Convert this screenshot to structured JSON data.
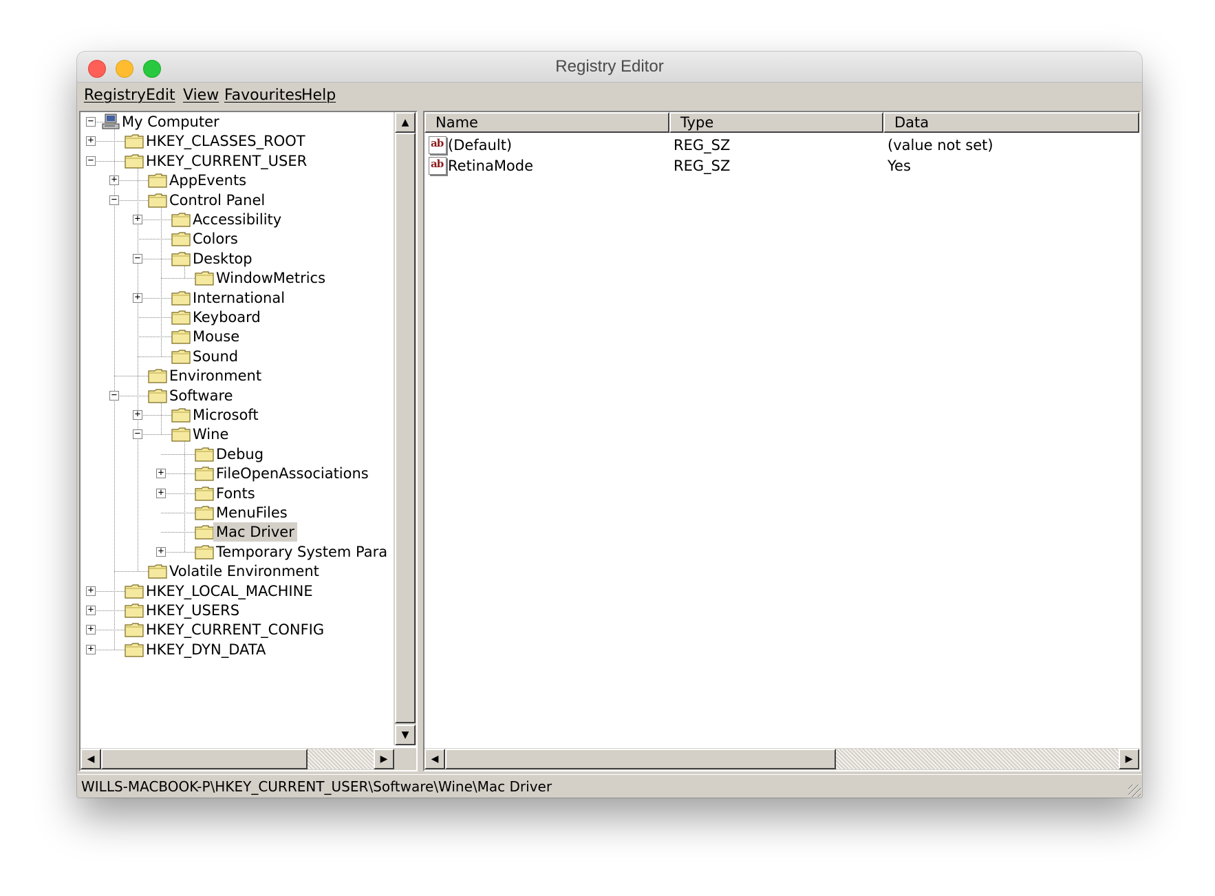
{
  "window": {
    "title": "Registry Editor"
  },
  "menu": [
    "Registry",
    "Edit",
    "View",
    "Favourites",
    "Help"
  ],
  "tree": {
    "root": {
      "label": "My Computer",
      "toggle": "−"
    },
    "nodes": [
      {
        "label": "HKEY_CLASSES_ROOT",
        "toggle": "+"
      },
      {
        "label": "HKEY_CURRENT_USER",
        "toggle": "−"
      },
      {
        "label": "AppEvents",
        "toggle": "+"
      },
      {
        "label": "Control Panel",
        "toggle": "−"
      },
      {
        "label": "Accessibility",
        "toggle": "+"
      },
      {
        "label": "Colors",
        "toggle": ""
      },
      {
        "label": "Desktop",
        "toggle": "−"
      },
      {
        "label": "WindowMetrics",
        "toggle": ""
      },
      {
        "label": "International",
        "toggle": "+"
      },
      {
        "label": "Keyboard",
        "toggle": ""
      },
      {
        "label": "Mouse",
        "toggle": ""
      },
      {
        "label": "Sound",
        "toggle": ""
      },
      {
        "label": "Environment",
        "toggle": ""
      },
      {
        "label": "Software",
        "toggle": "−"
      },
      {
        "label": "Microsoft",
        "toggle": "+"
      },
      {
        "label": "Wine",
        "toggle": "−"
      },
      {
        "label": "Debug",
        "toggle": ""
      },
      {
        "label": "FileOpenAssociations",
        "toggle": "+"
      },
      {
        "label": "Fonts",
        "toggle": "+"
      },
      {
        "label": "MenuFiles",
        "toggle": ""
      },
      {
        "label": "Mac Driver",
        "toggle": "",
        "selected": true
      },
      {
        "label": "Temporary System Para",
        "toggle": "+"
      },
      {
        "label": "Volatile Environment",
        "toggle": ""
      },
      {
        "label": "HKEY_LOCAL_MACHINE",
        "toggle": "+"
      },
      {
        "label": "HKEY_USERS",
        "toggle": "+"
      },
      {
        "label": "HKEY_CURRENT_CONFIG",
        "toggle": "+"
      },
      {
        "label": "HKEY_DYN_DATA",
        "toggle": "+"
      }
    ]
  },
  "list": {
    "columns": [
      "Name",
      "Type",
      "Data"
    ],
    "rows": [
      {
        "icon": "ab",
        "name": "(Default)",
        "type": "REG_SZ",
        "data": "(value not set)"
      },
      {
        "icon": "ab",
        "name": "RetinaMode",
        "type": "REG_SZ",
        "data": "Yes"
      }
    ]
  },
  "status": {
    "path": "WILLS-MACBOOK-P\\HKEY_CURRENT_USER\\Software\\Wine\\Mac Driver"
  },
  "scrollbars": {
    "up_arrow": "▲",
    "down_arrow": "▼",
    "left_arrow": "◀",
    "right_arrow": "▶"
  }
}
